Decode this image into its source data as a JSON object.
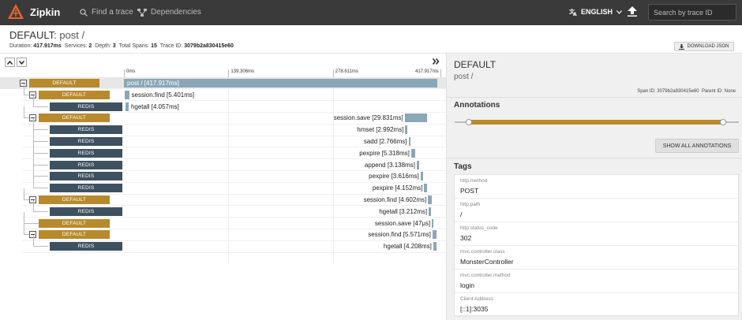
{
  "nav": {
    "brand": "Zipkin",
    "find_trace": "Find a trace",
    "dependencies": "Dependencies",
    "language": "ENGLISH",
    "search_placeholder": "Search by trace ID"
  },
  "trace": {
    "service": "DEFAULT",
    "span_name": "post /",
    "duration_label": "Duration:",
    "duration": "417.917ms",
    "services_label": "Services:",
    "services": "2",
    "depth_label": "Depth:",
    "depth": "3",
    "total_spans_label": "Total Spans:",
    "total_spans": "15",
    "trace_id_label": "Trace ID:",
    "trace_id": "3079b2a830415e60",
    "download_label": "DOWNLOAD JSON"
  },
  "timeline": {
    "ticks": [
      "0ms",
      "139.306ms",
      "278.611ms",
      "417.917ms"
    ],
    "total_ms": 417.917
  },
  "spans": [
    {
      "service": "DEFAULT",
      "label": "post / [417.917ms]",
      "start_ms": 0,
      "dur_ms": 417.917,
      "depth": 0,
      "has_toggle": true,
      "selected": true
    },
    {
      "service": "DEFAULT",
      "label": "session.find [5.401ms]",
      "start_ms": 1.5,
      "dur_ms": 5.401,
      "depth": 1,
      "has_toggle": true
    },
    {
      "service": "REDIS",
      "label": "hgetall [4.057ms]",
      "start_ms": 2.2,
      "dur_ms": 4.057,
      "depth": 2
    },
    {
      "service": "DEFAULT",
      "label": "session.save [29.831ms]",
      "start_ms": 374.5,
      "dur_ms": 29.831,
      "depth": 1,
      "has_toggle": true
    },
    {
      "service": "REDIS",
      "label": "hmset [2.992ms]",
      "start_ms": 375.2,
      "dur_ms": 2.992,
      "depth": 2
    },
    {
      "service": "REDIS",
      "label": "sadd [2.766ms]",
      "start_ms": 379.5,
      "dur_ms": 2.766,
      "depth": 2
    },
    {
      "service": "REDIS",
      "label": "pexpire [5.318ms]",
      "start_ms": 383.0,
      "dur_ms": 5.318,
      "depth": 2
    },
    {
      "service": "REDIS",
      "label": "append [3.138ms]",
      "start_ms": 390.5,
      "dur_ms": 3.138,
      "depth": 2
    },
    {
      "service": "REDIS",
      "label": "pexpire [3.616ms]",
      "start_ms": 395.5,
      "dur_ms": 3.616,
      "depth": 2
    },
    {
      "service": "REDIS",
      "label": "pexpire [4.152ms]",
      "start_ms": 400.5,
      "dur_ms": 4.152,
      "depth": 2
    },
    {
      "service": "DEFAULT",
      "label": "session.find [4.602ms]",
      "start_ms": 405.5,
      "dur_ms": 4.602,
      "depth": 1,
      "has_toggle": true
    },
    {
      "service": "REDIS",
      "label": "hgetall [3.212ms]",
      "start_ms": 406.5,
      "dur_ms": 3.212,
      "depth": 2
    },
    {
      "service": "DEFAULT",
      "label": "session.save [47μs]",
      "start_ms": 410.8,
      "dur_ms": 0.047,
      "depth": 1
    },
    {
      "service": "DEFAULT",
      "label": "session.find [5.571ms]",
      "start_ms": 411.5,
      "dur_ms": 5.571,
      "depth": 1,
      "has_toggle": true
    },
    {
      "service": "REDIS",
      "label": "hgetall [4.208ms]",
      "start_ms": 412.5,
      "dur_ms": 4.208,
      "depth": 2
    }
  ],
  "detail": {
    "service": "DEFAULT",
    "span_name": "post /",
    "span_id_label": "Span ID:",
    "span_id": "3079b2a830415e60",
    "parent_id_label": "Parent ID:",
    "parent_id": "None",
    "annotations_title": "Annotations",
    "show_all_label": "SHOW ALL ANNOTATIONS",
    "tags_title": "Tags",
    "tags": [
      {
        "key": "http.method",
        "value": "POST"
      },
      {
        "key": "http.path",
        "value": "/"
      },
      {
        "key": "http.status_code",
        "value": "302"
      },
      {
        "key": "mvc.controller.class",
        "value": "MonsterController"
      },
      {
        "key": "mvc.controller.method",
        "value": "login"
      },
      {
        "key": "Client Address",
        "value": "[::1]:3035"
      }
    ]
  },
  "colors": {
    "default_service": "#b88a2c",
    "redis_service": "#3d5160",
    "span_bar": "#8aa7b8",
    "topbar": "#3a3a3a"
  }
}
